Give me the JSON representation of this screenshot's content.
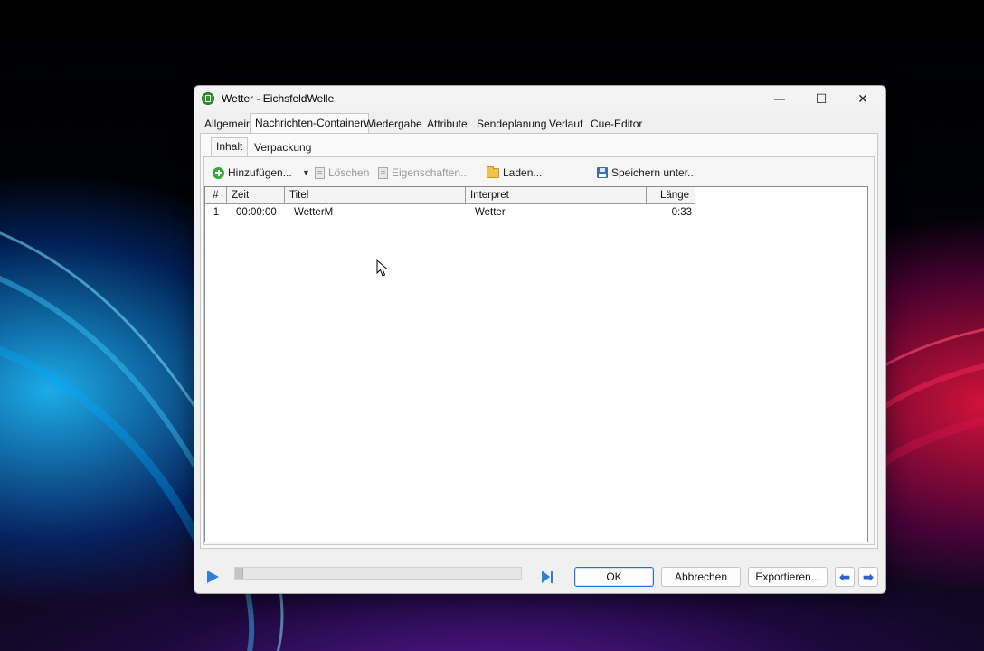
{
  "window": {
    "title": "Wetter - EichsfeldWelle",
    "controls": {
      "minimize": "—",
      "maximize": "☐",
      "close": "✕"
    }
  },
  "tabs": [
    {
      "label": "Allgemein"
    },
    {
      "label": "Nachrichten-Container",
      "active": true
    },
    {
      "label": "Wiedergabe"
    },
    {
      "label": "Attribute"
    },
    {
      "label": "Sendeplanung"
    },
    {
      "label": "Verlauf"
    },
    {
      "label": "Cue-Editor"
    }
  ],
  "subtabs": [
    {
      "label": "Inhalt",
      "active": true
    },
    {
      "label": "Verpackung"
    }
  ],
  "toolbar": {
    "add_label": "Hinzufügen...",
    "delete_label": "Löschen",
    "properties_label": "Eigenschaften...",
    "load_label": "Laden...",
    "save_as_label": "Speichern unter..."
  },
  "table": {
    "columns": [
      "#",
      "Zeit",
      "Titel",
      "Interpret",
      "Länge"
    ],
    "rows": [
      {
        "num": "1",
        "time": "00:00:00",
        "title": "WetterM",
        "artist": "Wetter",
        "length": "0:33"
      }
    ]
  },
  "player": {
    "progress": 0.0
  },
  "buttons": {
    "ok": "OK",
    "cancel": "Abbrechen",
    "export": "Exportieren...",
    "prev": "⬅",
    "next": "➡"
  },
  "colors": {
    "accent": "#2f7ed8",
    "default_button_border": "#2a6fce",
    "app_icon": "#2e9a2e"
  }
}
